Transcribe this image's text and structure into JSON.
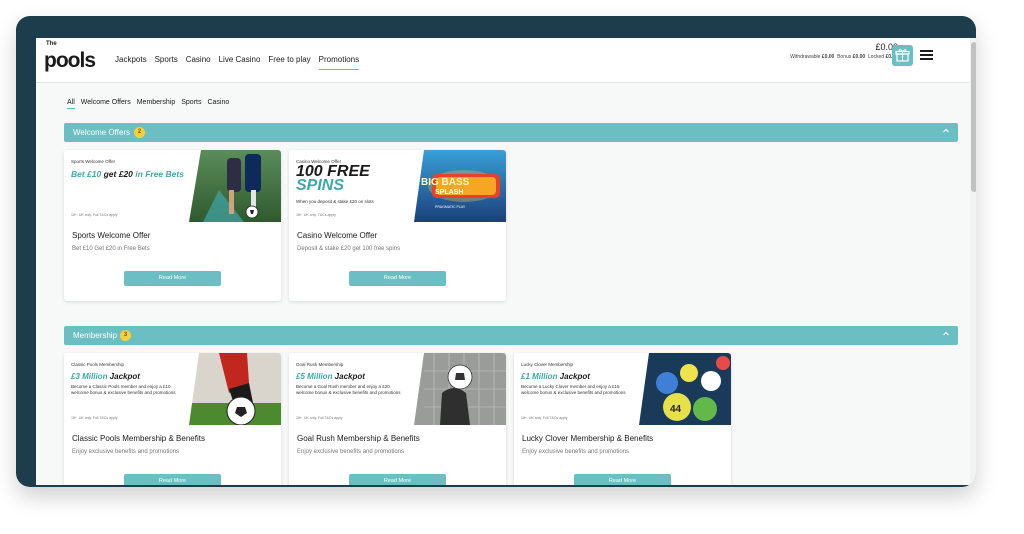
{
  "header": {
    "logo_the": "The",
    "logo_text": "pools",
    "nav": [
      "Jackpots",
      "Sports",
      "Casino",
      "Live Casino",
      "Free to play",
      "Promotions"
    ],
    "active_nav": "Promotions",
    "balance": "£0.00",
    "withdrawable_label": "Withdrawable",
    "withdrawable_value": "£0.00",
    "bonus_label": "Bonus",
    "bonus_value": "£0.00",
    "locked_label": "Locked",
    "locked_value": "£0.00",
    "gift_icon": "gift-icon",
    "menu_icon": "hamburger-menu-icon"
  },
  "filters": [
    "All",
    "Welcome Offers",
    "Membership",
    "Sports",
    "Casino"
  ],
  "active_filter": "All",
  "colors": {
    "accent": "#6bbec1",
    "badge": "#f3d13f",
    "frame": "#1d3d4c"
  },
  "sections": [
    {
      "title": "Welcome Offers",
      "count": "2",
      "cards": [
        {
          "eyebrow": "Sports Welcome Offer",
          "headline_a": "Bet £10",
          "headline_b": " get £20 ",
          "headline_c": "in Free Bets",
          "fine": "18+. UK only. Full T&Cs apply",
          "title": "Sports Welcome Offer",
          "desc": "Bet £10 Get £20 in Free Bets",
          "button": "Read More"
        },
        {
          "eyebrow": "Casino Welcome Offer",
          "headline_a": "100 FREE",
          "headline_b": "SPINS",
          "subline": "When you deposit & stake £20 on slots",
          "game_line1": "BIG BASS",
          "game_line2": "SPLASH",
          "game_brand": "PRAGMATIC PLAY",
          "title": "Casino Welcome Offer",
          "desc": "Deposit & stake £20 get 100 free spins",
          "button": "Read More"
        }
      ]
    },
    {
      "title": "Membership",
      "count": "3",
      "cards": [
        {
          "eyebrow": "Classic Pools Membership",
          "headline_a": "£3 Million",
          "headline_b": " Jackpot",
          "small": "Become a Classic Pools member and enjoy a £10 welcome bonus & exclusive benefits and promotions",
          "fine": "18+. UK only. Full T&Cs apply",
          "title": "Classic Pools Membership & Benefits",
          "desc": "Enjoy exclusive benefits and promotions",
          "button": "Read More"
        },
        {
          "eyebrow": "Goal Rush Membership",
          "headline_a": "£5 Million",
          "headline_b": " Jackpot",
          "small": "Become a Goal Rush member and enjoy a £20 welcome bonus & exclusive benefits and promotions",
          "fine": "18+. UK only. Full T&Cs apply",
          "title": "Goal Rush Membership & Benefits",
          "desc": "Enjoy exclusive benefits and promotions",
          "button": "Read More"
        },
        {
          "eyebrow": "Lucky Clover Membership",
          "headline_a": "£1 Million",
          "headline_b": " Jackpot",
          "small": "Become a Lucky Clover member and enjoy a £15 welcome bonus & exclusive benefits and promotions",
          "fine": "18+. UK only. Full T&Cs apply",
          "title": "Lucky Clover Membership & Benefits",
          "desc": "Enjoy exclusive benefits and promotions",
          "button": "Read More"
        }
      ]
    }
  ]
}
